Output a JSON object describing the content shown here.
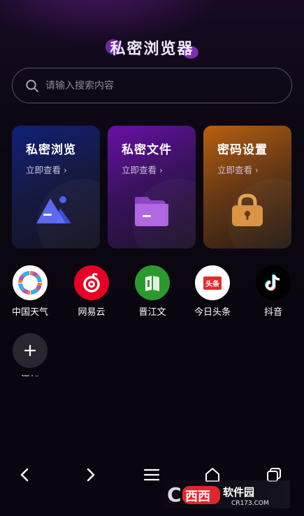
{
  "title": "私密浏览器",
  "search": {
    "placeholder": "请输入搜索内容"
  },
  "cards": [
    {
      "title": "私密浏览",
      "sub": "立即查看",
      "color": "#1c2fa8"
    },
    {
      "title": "私密文件",
      "sub": "立即查看",
      "color": "#7a18c0"
    },
    {
      "title": "密码设置",
      "sub": "立即查看",
      "color": "#c06a12"
    }
  ],
  "apps": [
    {
      "label": "中国天气"
    },
    {
      "label": "网易云"
    },
    {
      "label": "晋江文"
    },
    {
      "label": "今日头条"
    },
    {
      "label": "抖音"
    }
  ],
  "add": {
    "label": "添加"
  },
  "toutiao_icon_text": "头条",
  "watermark": {
    "brand": "西西软件园",
    "url": "CR173.COM"
  },
  "colors": {
    "background": "#0a0610",
    "netease": "#e60026",
    "jinjiang": "#2a9a2e"
  }
}
